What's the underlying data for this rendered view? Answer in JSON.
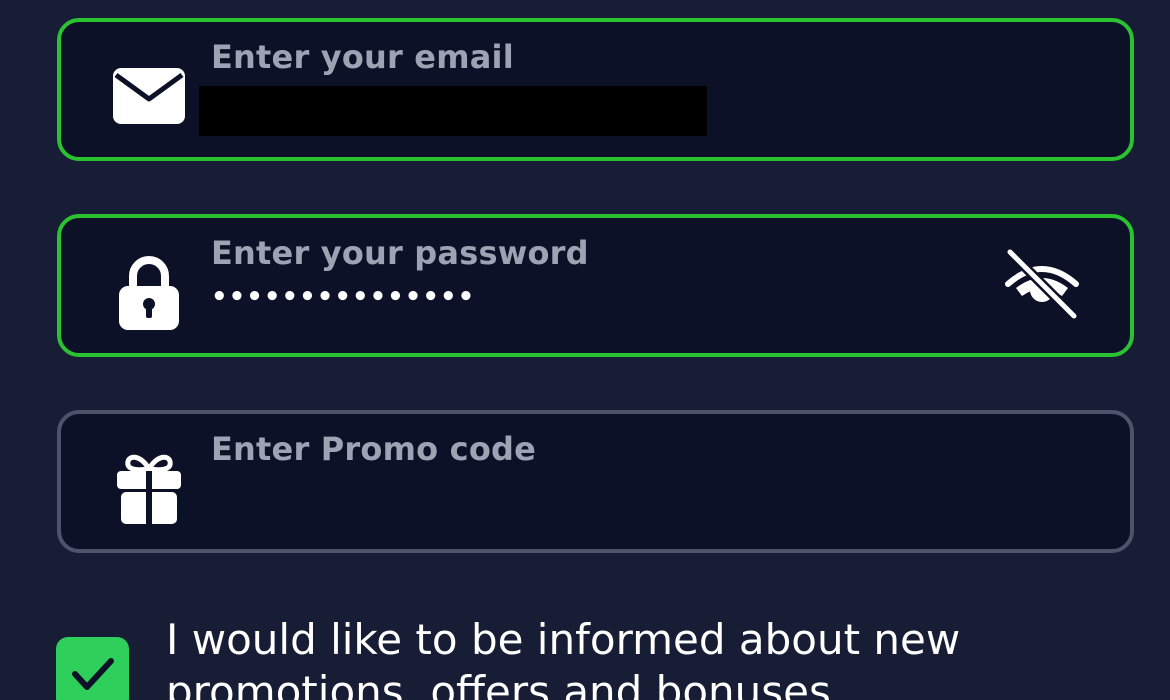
{
  "form": {
    "email": {
      "label": "Enter your email",
      "icon": "envelope-icon"
    },
    "password": {
      "label": "Enter your password",
      "value_masked": "•••••••••••••••",
      "icon": "lock-icon",
      "toggle_icon": "eye-off-icon"
    },
    "promo": {
      "label": "Enter Promo code",
      "icon": "gift-icon"
    },
    "consent": {
      "checked": true,
      "text": "I would like to be informed about new promotions, offers and bonuses"
    }
  },
  "colors": {
    "background": "#171d35",
    "field_background": "#0c1128",
    "active_border": "#2bc232",
    "idle_border": "#4d536a",
    "label_text": "#9ea3b3",
    "checkbox": "#2ecf5a"
  }
}
